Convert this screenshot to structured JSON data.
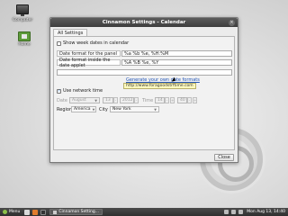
{
  "desktop": {
    "icons": [
      {
        "label": "Computer"
      },
      {
        "label": "Home"
      }
    ]
  },
  "window": {
    "title": "Cinnamon Settings - Calendar",
    "tab_label": "All Settings",
    "show_week_dates_label": "Show week dates in calendar",
    "format_panel_label": "Date format for the panel",
    "format_panel_value": "%a %b %e, %H:%M",
    "format_applet_label": "Date format inside the date applet",
    "format_applet_value": "%A %B %e, %Y",
    "generate_link": "Generate your own date formats",
    "tooltip_url": "http://www.foragoodstrftime.com",
    "use_network_time_label": "Use network time",
    "date_label": "Date",
    "month_value": "August",
    "day_value": "13",
    "year_value": "2012",
    "time_label": "Time",
    "hour_value": "14",
    "minute_value": "40",
    "region_label": "Region",
    "region_value": "America",
    "city_label": "City",
    "city_value": "New York",
    "close_label": "Close"
  },
  "taskbar": {
    "menu_label": "Menu",
    "task_label": "Cinnamon Setting...",
    "clock": "Mon Aug 13, 14:40"
  }
}
